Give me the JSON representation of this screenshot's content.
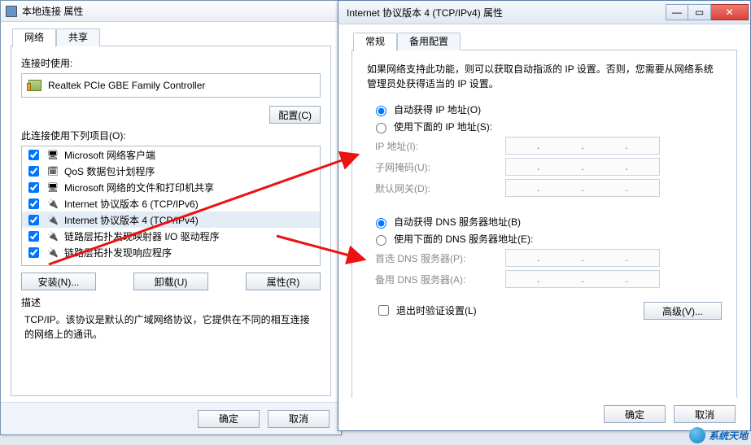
{
  "left": {
    "title": "本地连接 属性",
    "tabs": {
      "network": "网络",
      "share": "共享"
    },
    "connect_using_label": "连接时使用:",
    "adapter": "Realtek PCIe GBE Family Controller",
    "configure_btn": "配置(C)",
    "items_label": "此连接使用下列项目(O):",
    "items": [
      {
        "label": "Microsoft 网络客户端",
        "icon": "🖥",
        "checked": true
      },
      {
        "label": "QoS 数据包计划程序",
        "icon": "🗓",
        "checked": true
      },
      {
        "label": "Microsoft 网络的文件和打印机共享",
        "icon": "🖥",
        "checked": true
      },
      {
        "label": "Internet 协议版本 6 (TCP/IPv6)",
        "icon": "🔌",
        "checked": true
      },
      {
        "label": "Internet 协议版本 4 (TCP/IPv4)",
        "icon": "🔌",
        "checked": true,
        "selected": true
      },
      {
        "label": "链路层拓扑发现映射器 I/O 驱动程序",
        "icon": "🔌",
        "checked": true
      },
      {
        "label": "链路层拓扑发现响应程序",
        "icon": "🔌",
        "checked": true
      }
    ],
    "install_btn": "安装(N)...",
    "uninstall_btn": "卸载(U)",
    "properties_btn": "属性(R)",
    "desc_label": "描述",
    "desc_text": "TCP/IP。该协议是默认的广域网络协议，它提供在不同的相互连接的网络上的通讯。",
    "ok_btn": "确定",
    "cancel_btn": "取消"
  },
  "right": {
    "title": "Internet 协议版本 4 (TCP/IPv4) 属性",
    "win_min": "—",
    "win_max": "▭",
    "win_close": "✕",
    "tabs": {
      "general": "常规",
      "alt": "备用配置"
    },
    "info": "如果网络支持此功能，则可以获取自动指派的 IP 设置。否则，您需要从网络系统管理员处获得适当的 IP 设置。",
    "ip_auto": "自动获得 IP 地址(O)",
    "ip_manual": "使用下面的 IP 地址(S):",
    "ip_fields": {
      "ip": "IP 地址(I):",
      "mask": "子网掩码(U):",
      "gw": "默认网关(D):"
    },
    "dns_auto": "自动获得 DNS 服务器地址(B)",
    "dns_manual": "使用下面的 DNS 服务器地址(E):",
    "dns_fields": {
      "pref": "首选 DNS 服务器(P):",
      "alt": "备用 DNS 服务器(A):"
    },
    "validate": "退出时验证设置(L)",
    "advanced_btn": "高级(V)...",
    "ok_btn": "确定",
    "cancel_btn": "取消"
  },
  "watermark": "系统天地"
}
